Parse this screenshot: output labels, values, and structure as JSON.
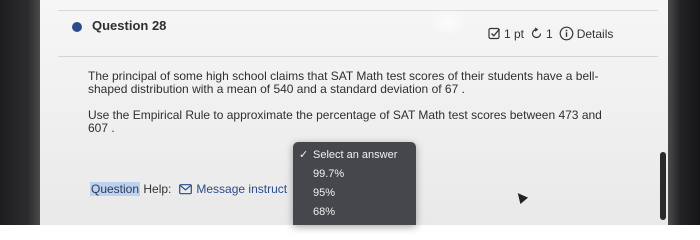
{
  "question": {
    "title": "Question 28",
    "points": "1 pt",
    "retries": "1",
    "details_label": "Details"
  },
  "body": {
    "paragraph1": "The principal of some high school claims that SAT Math test scores of their students have a bell-shaped distribution with a mean of 540 and a standard deviation of 67 .",
    "paragraph2": "Use the Empirical Rule to approximate the percentage of SAT Math test scores between 473 and 607 ."
  },
  "help": {
    "prefix": "Question",
    "suffix": "Help:",
    "message_label": "Message instruct"
  },
  "dropdown": {
    "options": [
      {
        "label": "Select an answer",
        "selected": true
      },
      {
        "label": "99.7%",
        "selected": false
      },
      {
        "label": "95%",
        "selected": false
      },
      {
        "label": "68%",
        "selected": false
      }
    ],
    "check_glyph": "✓"
  },
  "colors": {
    "accent": "#2c4b8a",
    "dropdown_bg": "#46474c",
    "highlight": "#bcd2ee"
  },
  "icons": {
    "points": "checkbox-icon",
    "retries": "retry-icon",
    "details": "info-icon",
    "message": "envelope-icon"
  }
}
